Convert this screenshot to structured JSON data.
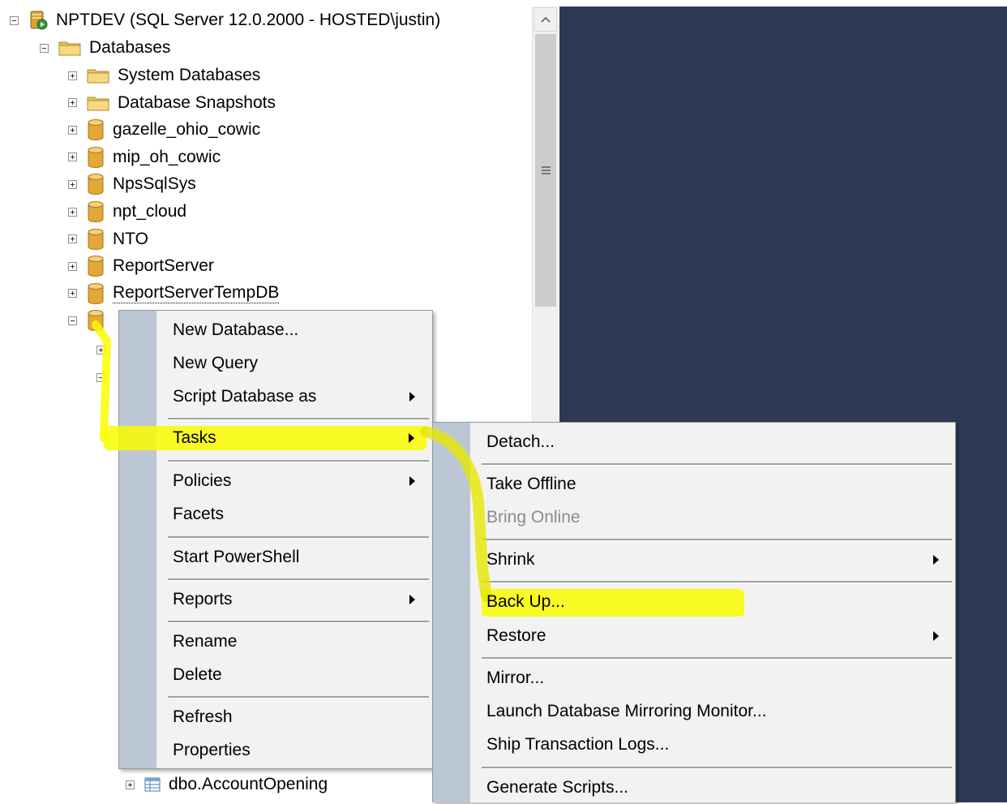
{
  "tree": {
    "server_label": "NPTDEV (SQL Server 12.0.2000 - HOSTED\\justin)",
    "databases_label": "Databases",
    "items": [
      {
        "label": "System Databases",
        "icon": "folder-icon"
      },
      {
        "label": "Database Snapshots",
        "icon": "folder-icon"
      },
      {
        "label": "gazelle_ohio_cowic",
        "icon": "database-icon"
      },
      {
        "label": "mip_oh_cowic",
        "icon": "database-icon"
      },
      {
        "label": "NpsSqlSys",
        "icon": "database-icon"
      },
      {
        "label": "npt_cloud",
        "icon": "database-icon"
      },
      {
        "label": "NTO",
        "icon": "database-icon"
      },
      {
        "label": "ReportServer",
        "icon": "database-icon"
      },
      {
        "label": "ReportServerTempDB",
        "icon": "database-icon"
      }
    ],
    "table_label": "dbo.AccountOpening"
  },
  "context_menu": {
    "items": [
      {
        "label": "New Database...",
        "submenu": false
      },
      {
        "label": "New Query",
        "submenu": false
      },
      {
        "label": "Script Database as",
        "submenu": true
      },
      {
        "label": "Tasks",
        "submenu": true,
        "highlighted": true
      },
      {
        "label": "Policies",
        "submenu": true
      },
      {
        "label": "Facets",
        "submenu": false
      },
      {
        "label": "Start PowerShell",
        "submenu": false
      },
      {
        "label": "Reports",
        "submenu": true
      },
      {
        "label": "Rename",
        "submenu": false
      },
      {
        "label": "Delete",
        "submenu": false
      },
      {
        "label": "Refresh",
        "submenu": false
      },
      {
        "label": "Properties",
        "submenu": false
      }
    ]
  },
  "tasks_menu": {
    "items": [
      {
        "label": "Detach...",
        "submenu": false
      },
      {
        "label": "Take Offline",
        "submenu": false
      },
      {
        "label": "Bring Online",
        "submenu": false,
        "disabled": true
      },
      {
        "label": "Shrink",
        "submenu": true
      },
      {
        "label": "Back Up...",
        "submenu": false,
        "highlighted": true
      },
      {
        "label": "Restore",
        "submenu": true
      },
      {
        "label": "Mirror...",
        "submenu": false
      },
      {
        "label": "Launch Database Mirroring Monitor...",
        "submenu": false
      },
      {
        "label": "Ship Transaction Logs...",
        "submenu": false
      },
      {
        "label": "Generate Scripts...",
        "submenu": false
      }
    ]
  },
  "colors": {
    "highlight": "#fbfb00",
    "menu_background": "#f2f2f2",
    "menu_gutter": "#bcc7d6",
    "right_panel": "#2c3a55"
  }
}
